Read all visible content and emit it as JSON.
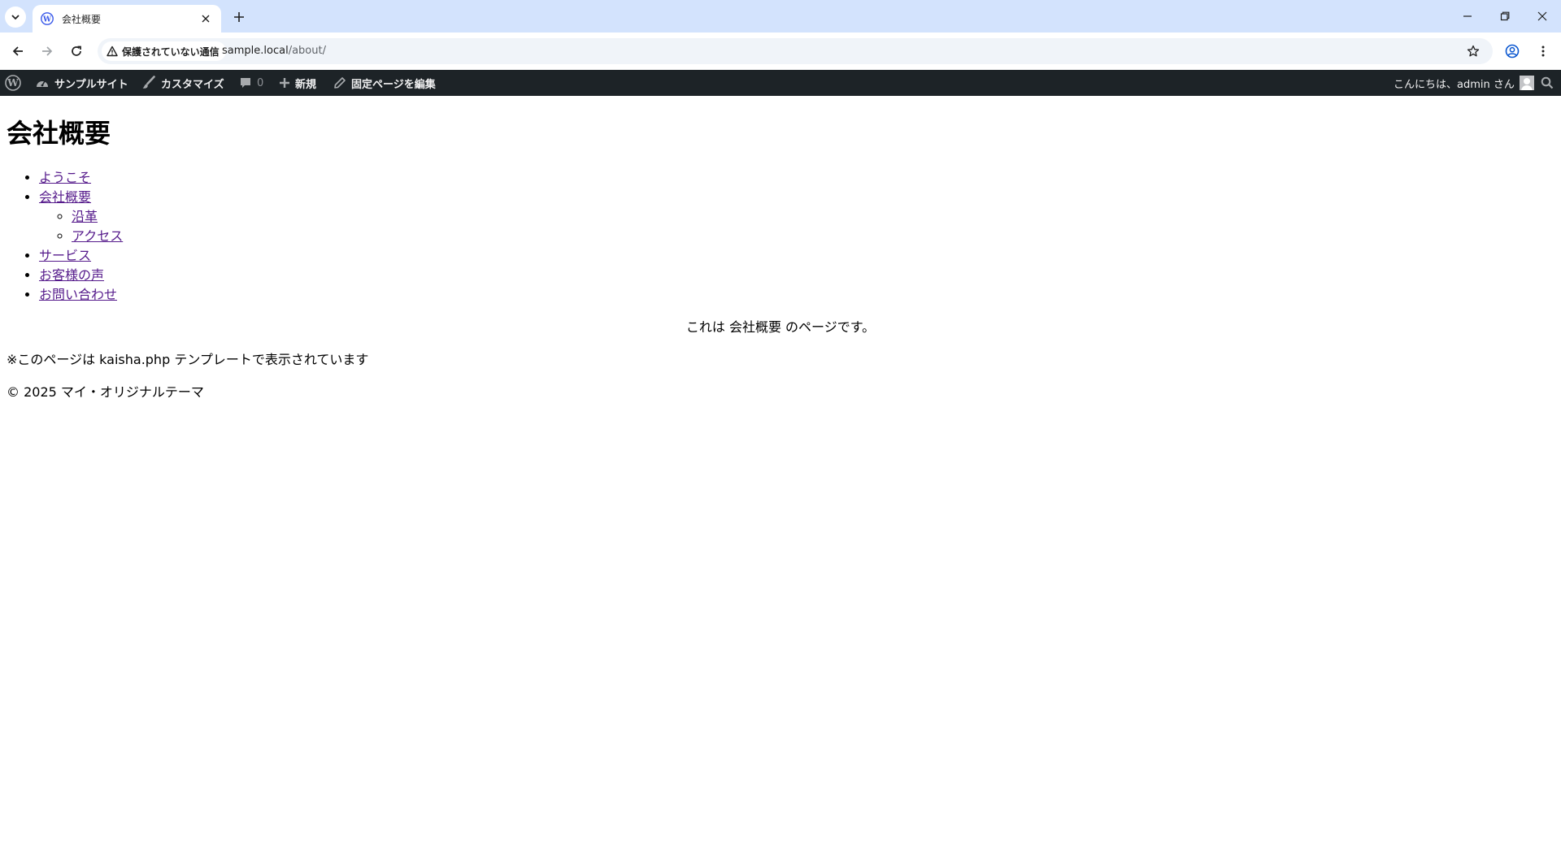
{
  "browser": {
    "tab_title": "会社概要",
    "security_label": "保護されていない通信",
    "url_host": "sample.local",
    "url_path": "/about/"
  },
  "adminbar": {
    "site_name": "サンプルサイト",
    "customize": "カスタマイズ",
    "comments_count": "0",
    "new": "新規",
    "edit_page": "固定ページを編集",
    "greeting": "こんにちは、admin さん"
  },
  "page": {
    "title": "会社概要",
    "menu": [
      {
        "label": "ようこそ"
      },
      {
        "label": "会社概要",
        "children": [
          {
            "label": "沿革"
          },
          {
            "label": "アクセス"
          }
        ]
      },
      {
        "label": "サービス"
      },
      {
        "label": "お客様の声"
      },
      {
        "label": "お問い合わせ"
      }
    ],
    "body_text": "これは 会社概要 のページです。",
    "template_note": "※このページは kaisha.php テンプレートで表示されています",
    "footer": "© 2025 マイ・オリジナルテーマ"
  },
  "colors": {
    "tabstrip": "#d3e3fd",
    "adminbar": "#1d2327",
    "link_visited": "#551a8b"
  }
}
